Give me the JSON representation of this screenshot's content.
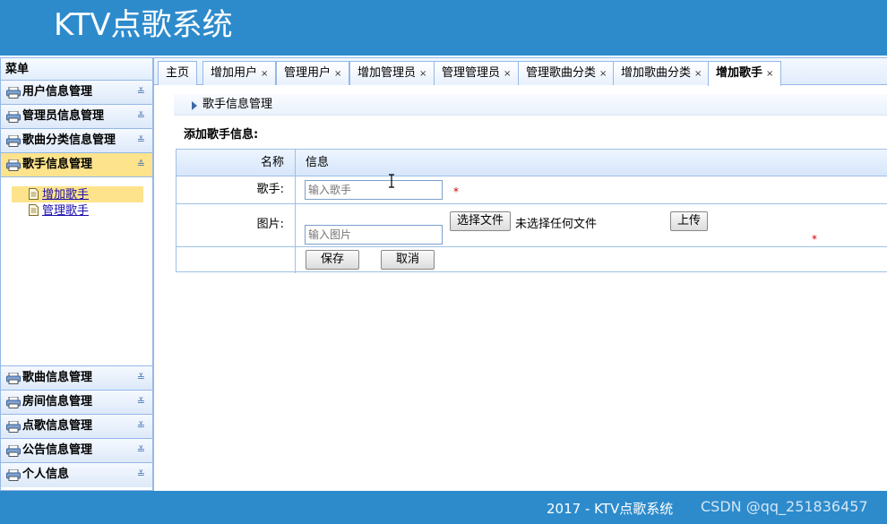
{
  "app": {
    "title": "KTV点歌系统"
  },
  "sidebar": {
    "title": "菜单",
    "top_groups": [
      {
        "label": "用户信息管理"
      },
      {
        "label": "管理员信息管理"
      },
      {
        "label": "歌曲分类信息管理"
      }
    ],
    "active_group": {
      "label": "歌手信息管理",
      "items": [
        {
          "label": "增加歌手",
          "selected": true
        },
        {
          "label": "管理歌手",
          "selected": false
        }
      ]
    },
    "bottom_groups": [
      {
        "label": "歌曲信息管理"
      },
      {
        "label": "房间信息管理"
      },
      {
        "label": "点歌信息管理"
      },
      {
        "label": "公告信息管理"
      },
      {
        "label": "个人信息"
      }
    ]
  },
  "tabs": [
    {
      "label": "主页",
      "closable": false
    },
    {
      "label": "增加用户",
      "closable": true
    },
    {
      "label": "管理用户",
      "closable": true
    },
    {
      "label": "增加管理员",
      "closable": true
    },
    {
      "label": "管理管理员",
      "closable": true
    },
    {
      "label": "管理歌曲分类",
      "closable": true
    },
    {
      "label": "增加歌曲分类",
      "closable": true
    },
    {
      "label": "增加歌手",
      "closable": true,
      "active": true
    }
  ],
  "tab_close_glyph": "×",
  "breadcrumb": "歌手信息管理",
  "form": {
    "title": "添加歌手信息:",
    "header_name": "名称",
    "header_info": "信息",
    "singer_label": "歌手:",
    "singer_placeholder": "输入歌手",
    "required_mark": "*",
    "image_label": "图片:",
    "choose_file_label": "选择文件",
    "no_file_text": "未选择任何文件",
    "upload_label": "上传",
    "image_placeholder": "输入图片",
    "save_label": "保存",
    "cancel_label": "取消"
  },
  "footer": {
    "text": "2017 - KTV点歌系统",
    "watermark": "CSDN @qq_251836457"
  },
  "colors": {
    "header_bg": "#2d8bcc",
    "selected_bg": "#fde38c",
    "border": "#95b8e7",
    "required": "#cc0000"
  },
  "icons": {
    "group": "printer-icon",
    "item": "document-icon",
    "expand": "chevron-double-down-icon",
    "collapse": "chevron-double-up-icon"
  }
}
